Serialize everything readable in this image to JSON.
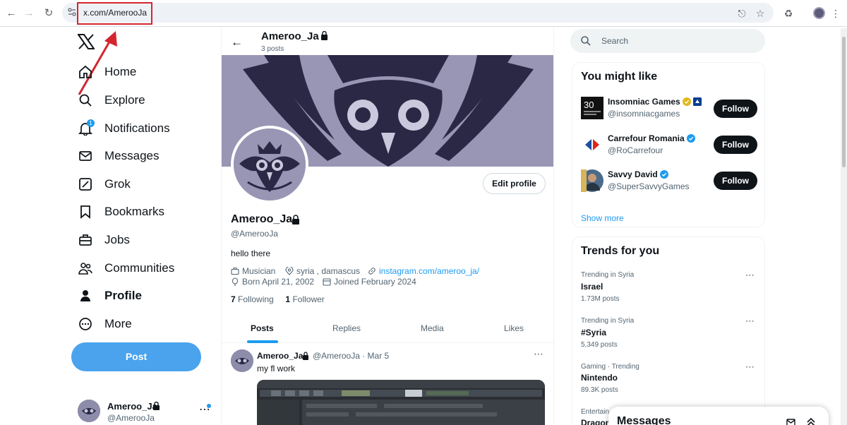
{
  "browser": {
    "url": "x.com/AmerooJa"
  },
  "nav": {
    "items": [
      {
        "label": "Home",
        "icon": "home-icon"
      },
      {
        "label": "Explore",
        "icon": "search-icon"
      },
      {
        "label": "Notifications",
        "icon": "bell-icon",
        "badge": "1"
      },
      {
        "label": "Messages",
        "icon": "envelope-icon"
      },
      {
        "label": "Grok",
        "icon": "grok-icon"
      },
      {
        "label": "Bookmarks",
        "icon": "bookmark-icon"
      },
      {
        "label": "Jobs",
        "icon": "briefcase-icon"
      },
      {
        "label": "Communities",
        "icon": "communities-icon"
      },
      {
        "label": "Profile",
        "icon": "person-icon",
        "active": true
      },
      {
        "label": "More",
        "icon": "more-circle-icon"
      }
    ],
    "post_label": "Post",
    "account": {
      "name": "Ameroo_Ja",
      "handle": "@AmerooJa"
    }
  },
  "profile": {
    "header_name": "Ameroo_Ja",
    "post_count": "3 posts",
    "edit_label": "Edit profile",
    "name": "Ameroo_Ja",
    "handle": "@AmerooJa",
    "bio": "hello there",
    "category": "Musician",
    "location": "syria , damascus",
    "link": "instagram.com/ameroo_ja/",
    "born": "Born April 21, 2002",
    "joined": "Joined February 2024",
    "following_count": "7",
    "following_label": "Following",
    "followers_count": "1",
    "followers_label": "Follower"
  },
  "tabs": [
    "Posts",
    "Replies",
    "Media",
    "Likes"
  ],
  "tweet": {
    "name": "Ameroo_Ja",
    "meta": "@AmerooJa · Mar 5",
    "text": "my fl work"
  },
  "search": {
    "placeholder": "Search"
  },
  "you_might_like": {
    "title": "You might like",
    "accounts": [
      {
        "name": "Insomniac Games",
        "handle": "@insomniacgames",
        "follow": "Follow"
      },
      {
        "name": "Carrefour Romania",
        "handle": "@RoCarrefour",
        "follow": "Follow"
      },
      {
        "name": "Savvy David",
        "handle": "@SuperSavvyGames",
        "follow": "Follow"
      }
    ],
    "show_more": "Show more"
  },
  "trends": {
    "title": "Trends for you",
    "items": [
      {
        "context": "Trending in Syria",
        "name": "Israel",
        "count": "1.73M posts"
      },
      {
        "context": "Trending in Syria",
        "name": "#Syria",
        "count": "5,349 posts"
      },
      {
        "context": "Gaming · Trending",
        "name": "Nintendo",
        "count": "89.3K posts"
      },
      {
        "context": "Entertain",
        "name": "Dragon",
        "count": ""
      }
    ]
  },
  "messages_drawer": {
    "title": "Messages"
  },
  "colors": {
    "accent": "#1d9bf0",
    "post_button": "#4aa3ec",
    "highlight": "#d3262f"
  }
}
